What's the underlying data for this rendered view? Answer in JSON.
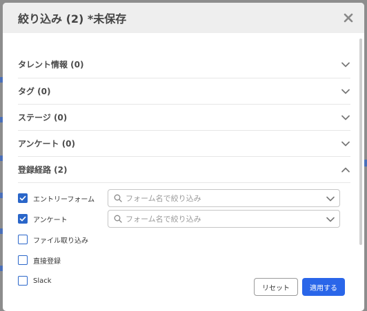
{
  "modal": {
    "title": "絞り込み (2) *未保存"
  },
  "sections": [
    {
      "label": "タレント情報 (0)"
    },
    {
      "label": "タグ (0)"
    },
    {
      "label": "ステージ (0)"
    },
    {
      "label": "アンケート (0)"
    },
    {
      "label": "登録経路 (2)"
    }
  ],
  "registration_route": {
    "options": [
      {
        "label": "エントリーフォーム",
        "checked": true,
        "select_placeholder": "フォーム名で絞り込み"
      },
      {
        "label": "アンケート",
        "checked": true,
        "select_placeholder": "フォーム名で絞り込み"
      },
      {
        "label": "ファイル取り込み",
        "checked": false
      },
      {
        "label": "直接登録",
        "checked": false
      },
      {
        "label": "Slack",
        "checked": false
      }
    ]
  },
  "footer": {
    "reset_label": "リセット",
    "apply_label": "適用する"
  },
  "colors": {
    "accent": "#2a66e9",
    "checkbox": "#2a66c9",
    "header_bg": "#eeeeee"
  }
}
